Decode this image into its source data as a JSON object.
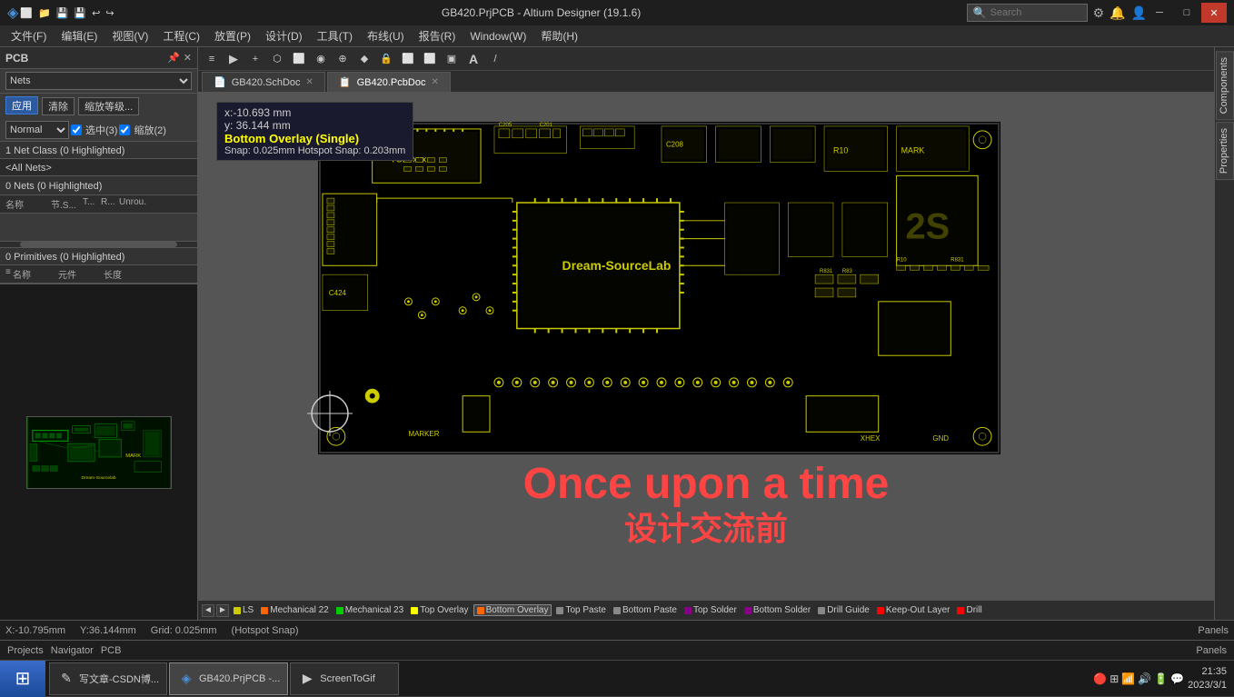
{
  "window": {
    "title": "GB420.PrjPCB - Altium Designer (19.1.6)",
    "search_placeholder": "Search"
  },
  "titlebar": {
    "title": "GB420.PrjPCB - Altium Designer (19.1.6)",
    "search_label": "Search",
    "minimize": "─",
    "restore": "□",
    "close": "✕"
  },
  "menubar": {
    "items": [
      "文件(F)",
      "编辑(E)",
      "视图(V)",
      "工程(C)",
      "放置(P)",
      "设计(D)",
      "工具(T)",
      "布线(U)",
      "报告(R)",
      "Window(W)",
      "帮助(H)"
    ]
  },
  "left_panel": {
    "title": "PCB",
    "tabs": [
      "Nets",
      "Navigator",
      "PCB"
    ],
    "nets_label": "Nets",
    "apply_btn": "应用",
    "clear_btn": "清除",
    "zoom_btn": "缩放等级...",
    "normal_label": "Normal",
    "select_label": "选中(3)",
    "zoom_label": "缩放(2)",
    "net_class_header": "1 Net Class (0 Highlighted)",
    "all_nets": "<All Nets>",
    "nets_count": "0 Nets (0 Highlighted)",
    "col_name": "名称",
    "col_node": "节.S...",
    "col_t": "T...",
    "col_r": "R...",
    "col_unrou": "Unrou.",
    "primitives_header": "0 Primitives (0 Highlighted)",
    "prim_col1": "名称",
    "prim_col2": "元件",
    "prim_col3": "长度"
  },
  "tabs": {
    "items": [
      {
        "label": "GB420.SchDoc",
        "active": false,
        "closable": true
      },
      {
        "label": "GB420.PcbDoc",
        "active": true,
        "closable": true,
        "modified": true
      }
    ]
  },
  "tooltip": {
    "x": "x:-10.693  mm",
    "y": "y: 36.144  mm",
    "layer": "Bottom Overlay (Single)",
    "snap": "Snap: 0.025mm Hotspot Snap: 0.203mm"
  },
  "canvas": {
    "background": "#555555"
  },
  "watermark": "Once upon a time",
  "watermark2": "设计交流前",
  "layer_tabs": {
    "nav_prev": "◄",
    "nav_next": "►",
    "items": [
      {
        "label": "LS",
        "color": "#cccc00"
      },
      {
        "label": "Mechanical 22",
        "color": "#ff6600"
      },
      {
        "label": "Mechanical 23",
        "color": "#00cc00"
      },
      {
        "label": "Top Overlay",
        "color": "#ffff00"
      },
      {
        "label": "Bottom Overlay",
        "color": "#ff6600",
        "active": true
      },
      {
        "label": "Top Paste",
        "color": "#888888"
      },
      {
        "label": "Bottom Paste",
        "color": "#888888"
      },
      {
        "label": "Top Solder",
        "color": "#880088"
      },
      {
        "label": "Bottom Solder",
        "color": "#880088"
      },
      {
        "label": "Drill Guide",
        "color": "#888888"
      },
      {
        "label": "Keep-Out Layer",
        "color": "#ff0000"
      },
      {
        "label": "Drill",
        "color": "#ff0000"
      }
    ]
  },
  "coords_bar": {
    "x": "X:-10.795mm",
    "y": "Y:36.144mm",
    "grid": "Grid: 0.025mm",
    "snap": "(Hotspot Snap)"
  },
  "statusbar": {
    "tabs": [
      "Projects",
      "Navigator",
      "PCB"
    ],
    "panels": "Panels"
  },
  "right_panel": {
    "components": "Components",
    "properties": "Properties"
  },
  "taskbar": {
    "start_icon": "⊞",
    "items": [
      {
        "label": "写文章-CSDN博...",
        "icon": "✎",
        "active": false
      },
      {
        "label": "GB420.PrjPCB -...",
        "icon": "◈",
        "active": true
      },
      {
        "label": "ScreenToGif",
        "icon": "▶",
        "active": false
      }
    ],
    "time": "21:35",
    "date": "2023/3/1",
    "tray_icons": [
      "🔴",
      "⊞",
      "📶",
      "🔊",
      "🔋",
      "💬"
    ]
  },
  "toolbar2_icons": [
    "≡",
    "▶",
    "+",
    "⬡",
    "⬜",
    "◉",
    "⊕",
    "⬦",
    "🔒",
    "⬜",
    "⬜",
    "▣",
    "A",
    "/"
  ]
}
